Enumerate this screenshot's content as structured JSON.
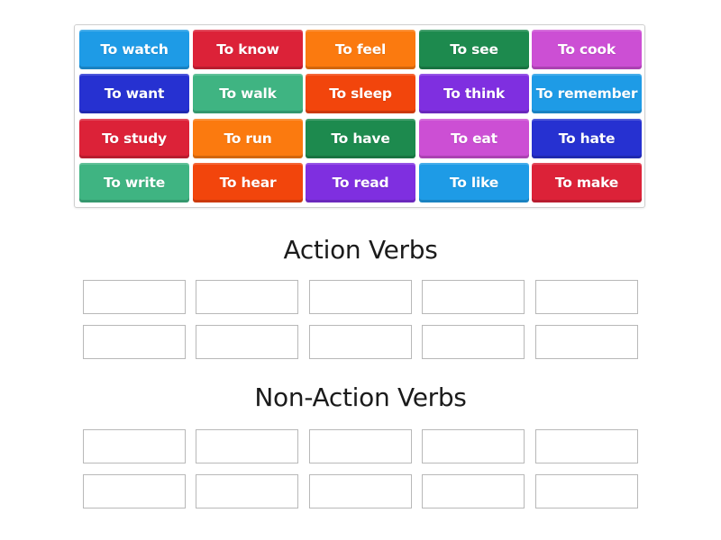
{
  "tiles": [
    {
      "label": "To watch",
      "color": "#1e9be6"
    },
    {
      "label": "To know",
      "color": "#dc2238"
    },
    {
      "label": "To feel",
      "color": "#fb7a0f"
    },
    {
      "label": "To see",
      "color": "#1d8a4e"
    },
    {
      "label": "To cook",
      "color": "#cc4fd4"
    },
    {
      "label": "To want",
      "color": "#2631d1"
    },
    {
      "label": "To walk",
      "color": "#3fb482"
    },
    {
      "label": "To sleep",
      "color": "#f2450c"
    },
    {
      "label": "To think",
      "color": "#7f2fe0"
    },
    {
      "label": "To remember",
      "color": "#1e9be6"
    },
    {
      "label": "To study",
      "color": "#dc2238"
    },
    {
      "label": "To run",
      "color": "#fb7a0f"
    },
    {
      "label": "To have",
      "color": "#1d8a4e"
    },
    {
      "label": "To eat",
      "color": "#cc4fd4"
    },
    {
      "label": "To hate",
      "color": "#2631d1"
    },
    {
      "label": "To write",
      "color": "#3fb482"
    },
    {
      "label": "To hear",
      "color": "#f2450c"
    },
    {
      "label": "To read",
      "color": "#7f2fe0"
    },
    {
      "label": "To like",
      "color": "#1e9be6"
    },
    {
      "label": "To make",
      "color": "#dc2238"
    }
  ],
  "groups": [
    {
      "title": "Action Verbs",
      "slots": 10
    },
    {
      "title": "Non-Action Verbs",
      "slots": 10
    }
  ]
}
